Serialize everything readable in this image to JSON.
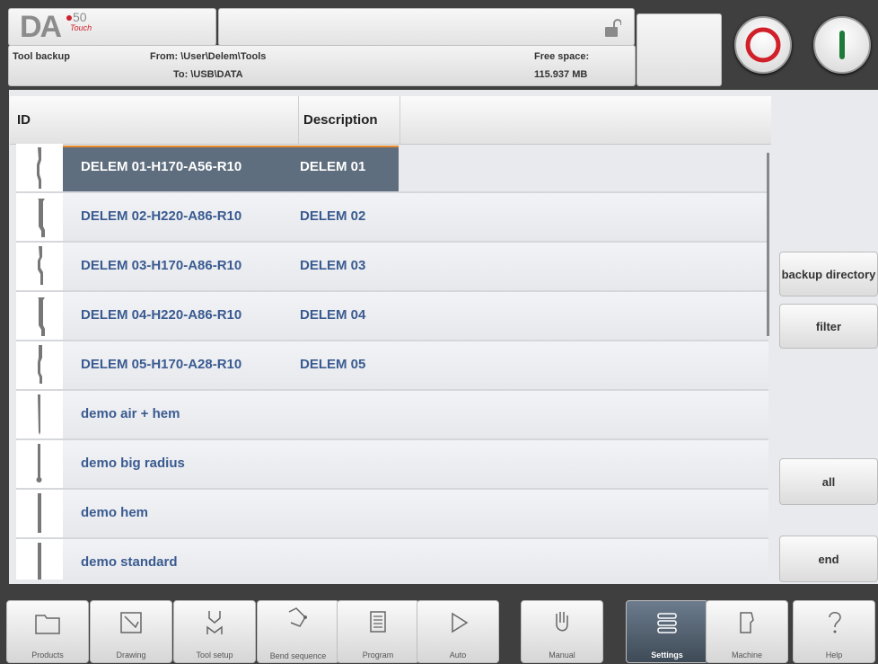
{
  "logo": {
    "brand": "DA",
    "version": "50",
    "edition": "Touch"
  },
  "header": {
    "title": "Tool backup",
    "from": "From: \\User\\Delem\\Tools",
    "to": "To: \\USB\\DATA",
    "free_space_label": "Free space:",
    "free_space_value": "115.937 MB"
  },
  "table": {
    "columns": [
      "ID",
      "Description"
    ],
    "rows": [
      {
        "id": "DELEM 01-H170-A56-R10",
        "description": "DELEM 01",
        "icon": "punch-gooseneck-icon",
        "selected": true
      },
      {
        "id": "DELEM 02-H220-A86-R10",
        "description": "DELEM 02",
        "icon": "punch-tall-icon",
        "selected": false
      },
      {
        "id": "DELEM 03-H170-A86-R10",
        "description": "DELEM 03",
        "icon": "punch-gooseneck-icon",
        "selected": false
      },
      {
        "id": "DELEM 04-H220-A86-R10",
        "description": "DELEM 04",
        "icon": "punch-tall-icon",
        "selected": false
      },
      {
        "id": "DELEM 05-H170-A28-R10",
        "description": "DELEM 05",
        "icon": "punch-gooseneck-icon",
        "selected": false
      },
      {
        "id": "demo air + hem",
        "description": "",
        "icon": "punch-straight-icon",
        "selected": false
      },
      {
        "id": "demo big radius",
        "description": "",
        "icon": "punch-radius-icon",
        "selected": false
      },
      {
        "id": "demo hem",
        "description": "",
        "icon": "punch-straight-icon",
        "selected": false
      },
      {
        "id": "demo standard",
        "description": "",
        "icon": "punch-straight-icon",
        "selected": false
      }
    ]
  },
  "side_buttons": {
    "backup_directory": "backup directory",
    "filter": "filter",
    "all": "all",
    "end": "end"
  },
  "nav": [
    {
      "label": "Products",
      "icon": "folder-icon"
    },
    {
      "label": "Drawing",
      "icon": "drawing-icon"
    },
    {
      "label": "Tool setup",
      "icon": "tool-setup-icon"
    },
    {
      "label": "Bend sequence",
      "icon": "bend-sequence-icon"
    },
    {
      "label": "Program",
      "icon": "program-icon"
    },
    {
      "label": "Auto",
      "icon": "play-icon"
    },
    {
      "label": "Manual",
      "icon": "hand-icon"
    },
    {
      "label": "Settings",
      "icon": "settings-icon",
      "active": true
    },
    {
      "label": "Machine",
      "icon": "machine-icon"
    },
    {
      "label": "Help",
      "icon": "help-icon"
    }
  ],
  "colors": {
    "accent": "#e88a2a",
    "selected_row": "#5f6e7e",
    "row_text": "#3a5b90",
    "stop": "#d0202a",
    "start": "#1e7a3a"
  }
}
